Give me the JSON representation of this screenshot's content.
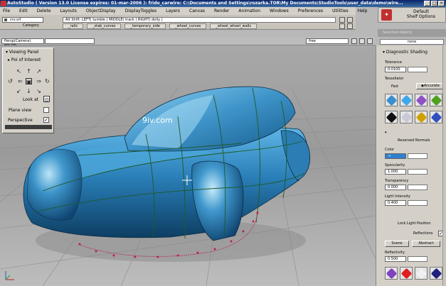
{
  "window": {
    "title": "AutoStudio ( Version 13.0  License expires: 01-mar-2006 ): frido_carwire: C:\\Documents and Settings\\rozarka.TOR\\My Documents\\StudioTools\\user_data\\demo\\wire..."
  },
  "menu": [
    "File",
    "Edit",
    "Delete",
    "Layouts",
    "ObjectDisplay",
    "DisplayToggles",
    "Layers",
    "Canvas",
    "Render",
    "Animation",
    "Windows",
    "Preferences",
    "Utilities",
    "Help"
  ],
  "shelf": {
    "name": "crv.srf",
    "category_label": "Category",
    "hotkey_hint": "Alt Shift:   LEFT( tumble )   MIDDLE( track )   RIGHT( dolly )",
    "tabs": [
      "_rails",
      "_stab_curves",
      "_temporary_side",
      "_wheel_curves",
      "_wheel_wheel_walls"
    ]
  },
  "shelf_options": {
    "label": "Default\nShelf Options"
  },
  "selected_objects": {
    "title": "Selected objects",
    "value": "none"
  },
  "viewport_toolbar": {
    "layer": "Persp(Camera) ers.cm",
    "view": "",
    "mode": "free"
  },
  "viewing_panel": {
    "title": "Viewing Panel",
    "poi": "Poi of Interest",
    "look_at": "Look at",
    "plane_view": "Plane view",
    "perspective": "Perspective",
    "perspective_checked": "✓"
  },
  "watermark": "9iv.com",
  "shading_panel": {
    "title": "Diagnostic Shading",
    "tolerance_label": "Tolerance",
    "tolerance_value": "0.0100",
    "tessellator_label": "Tessellator",
    "fast_label": "Fast",
    "accurate_label": "Accurate",
    "reversed_normals_label": "Reversed Normals",
    "color_label": "Color",
    "specularity_label": "Specularity",
    "specularity_value": "1.000",
    "transparency_label": "Transparency",
    "transparency_value": "0.000",
    "light_intensity_label": "Light Intensity",
    "light_intensity_value": "0.400",
    "lock_light_label": "Lock Light Position",
    "reflections_label": "Reflections",
    "reflections_checked": "✓",
    "scene_label": "Scene",
    "abstract_label": "Abstract",
    "reflectivity_label": "Reflectivity",
    "reflectivity_value": "0.500"
  },
  "colors": {
    "title_bar": "#0a246a",
    "car_body": "#2a7fb8",
    "viewport_bg": "#a8a8a8",
    "panel_bg": "#d4d0c8",
    "color_swatch": "#2f7fd0"
  },
  "shader_balls": [
    "#3a8fd0",
    "#3fa8e8",
    "#9050c8",
    "#50a020",
    "#101010",
    "#c8c8d8",
    "#d0a000",
    "#3050c0",
    "#8040c0",
    "#e02020",
    "#f0f0f0",
    "#202080"
  ]
}
